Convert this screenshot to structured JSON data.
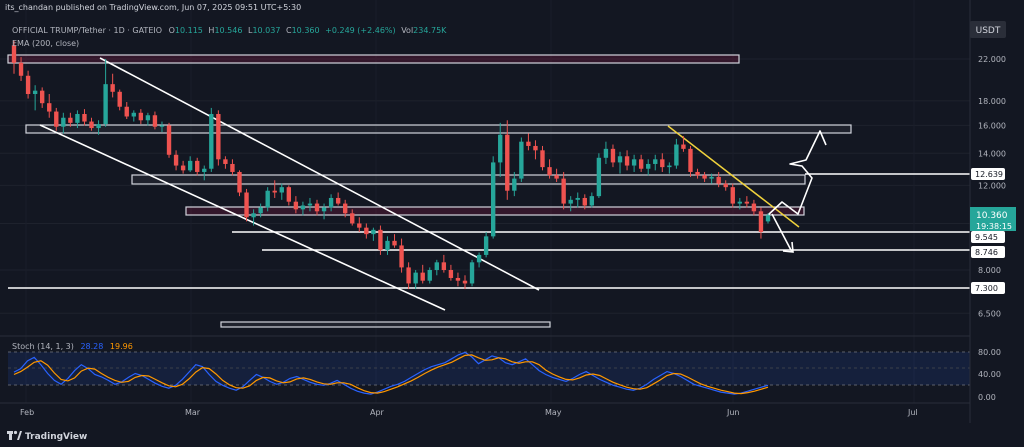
{
  "publish_line": "its_chandan published on TradingView.com, Jun 07, 2025 09:51 UTC+5:30",
  "symbol": {
    "name": "OFFICIAL TRUMP/Tether · 1D · GATEIO",
    "open_label": "O",
    "open": "10.115",
    "high_label": "H",
    "high": "10.546",
    "low_label": "L",
    "low": "10.037",
    "close_label": "C",
    "close": "10.360",
    "change": "+0.249 (+2.46%)",
    "volume_label": "Vol",
    "volume": "234.75K"
  },
  "ema_label": "EMA (200, close)",
  "currency": "USDT",
  "price_axis": {
    "ticks": [
      "22.000",
      "18.000",
      "16.000",
      "14.000",
      "12.000",
      "10.000",
      "8.000",
      "6.500"
    ],
    "badges": [
      "12.639",
      "9.545",
      "8.746",
      "7.300"
    ],
    "current_price": "10.360",
    "countdown": "19:38:15"
  },
  "stoch": {
    "label": "Stoch (14, 1, 3)",
    "k": "28.28",
    "d": "19.96",
    "ticks": [
      "80.00",
      "40.00",
      "0.00"
    ]
  },
  "time_axis": [
    "Feb",
    "Mar",
    "Apr",
    "May",
    "Jun",
    "Jul"
  ],
  "footer_brand": "TradingView",
  "colors": {
    "background": "#131722",
    "up": "#26a69a",
    "down": "#ef5350",
    "stoch_k": "#2962ff",
    "stoch_d": "#ff9800",
    "trendline": "#f0d23c"
  },
  "chart_data": {
    "type": "candlestick",
    "y_scale": "log",
    "interval": "1D",
    "ohlc_last": {
      "open": 10.115,
      "high": 10.546,
      "low": 10.037,
      "close": 10.36
    },
    "candles": [
      [
        23.5,
        24.0,
        20.5,
        21.6
      ],
      [
        21.6,
        22.2,
        19.8,
        20.3
      ],
      [
        20.3,
        20.8,
        18.2,
        18.6
      ],
      [
        18.6,
        19.4,
        17.2,
        18.9
      ],
      [
        18.9,
        19.2,
        17.4,
        17.8
      ],
      [
        17.8,
        18.6,
        16.6,
        17.1
      ],
      [
        17.1,
        17.4,
        15.6,
        15.9
      ],
      [
        15.9,
        17.0,
        15.4,
        16.6
      ],
      [
        16.6,
        17.0,
        15.9,
        16.2
      ],
      [
        16.2,
        17.2,
        15.8,
        16.9
      ],
      [
        16.9,
        17.3,
        16.0,
        16.3
      ],
      [
        16.3,
        16.6,
        15.6,
        15.8
      ],
      [
        15.8,
        16.4,
        15.3,
        16.1
      ],
      [
        16.1,
        22.0,
        15.9,
        19.5
      ],
      [
        19.5,
        20.5,
        18.3,
        18.8
      ],
      [
        18.8,
        19.0,
        17.2,
        17.5
      ],
      [
        17.5,
        17.9,
        16.5,
        16.7
      ],
      [
        16.7,
        17.2,
        16.3,
        17.0
      ],
      [
        17.0,
        17.3,
        16.1,
        16.4
      ],
      [
        16.4,
        17.0,
        16.0,
        16.8
      ],
      [
        16.8,
        17.1,
        15.7,
        15.9
      ],
      [
        15.9,
        16.3,
        15.5,
        16.0
      ],
      [
        16.0,
        16.2,
        13.7,
        13.9
      ],
      [
        13.9,
        14.2,
        12.9,
        13.2
      ],
      [
        13.2,
        13.5,
        12.7,
        12.9
      ],
      [
        12.9,
        13.8,
        12.8,
        13.5
      ],
      [
        13.5,
        13.7,
        12.6,
        12.8
      ],
      [
        12.8,
        13.2,
        12.3,
        13.0
      ],
      [
        13.0,
        17.4,
        12.8,
        16.9
      ],
      [
        16.9,
        17.2,
        13.2,
        13.6
      ],
      [
        13.6,
        13.8,
        13.0,
        13.3
      ],
      [
        13.3,
        13.6,
        12.6,
        12.8
      ],
      [
        12.8,
        12.9,
        11.4,
        11.6
      ],
      [
        11.6,
        11.8,
        10.1,
        10.3
      ],
      [
        10.3,
        10.7,
        9.9,
        10.5
      ],
      [
        10.5,
        11.0,
        10.3,
        10.8
      ],
      [
        10.8,
        11.9,
        10.6,
        11.7
      ],
      [
        11.7,
        12.3,
        11.3,
        11.6
      ],
      [
        11.6,
        12.1,
        11.2,
        11.9
      ],
      [
        11.9,
        12.0,
        10.9,
        11.1
      ],
      [
        11.1,
        11.4,
        10.5,
        10.7
      ],
      [
        10.7,
        11.1,
        10.4,
        10.9
      ],
      [
        10.9,
        11.3,
        10.6,
        11.0
      ],
      [
        11.0,
        11.2,
        10.4,
        10.6
      ],
      [
        10.6,
        11.0,
        10.2,
        10.8
      ],
      [
        10.8,
        11.5,
        10.6,
        11.3
      ],
      [
        11.3,
        11.6,
        10.9,
        11.0
      ],
      [
        11.0,
        11.2,
        10.3,
        10.5
      ],
      [
        10.5,
        10.7,
        9.9,
        10.0
      ],
      [
        10.0,
        10.3,
        9.6,
        9.8
      ],
      [
        9.8,
        10.0,
        9.3,
        9.5
      ],
      [
        9.5,
        9.8,
        9.2,
        9.7
      ],
      [
        9.7,
        9.9,
        8.6,
        8.8
      ],
      [
        8.8,
        9.4,
        8.6,
        9.2
      ],
      [
        9.2,
        9.5,
        8.9,
        9.0
      ],
      [
        9.0,
        9.3,
        7.9,
        8.1
      ],
      [
        8.1,
        8.3,
        7.3,
        7.5
      ],
      [
        7.5,
        8.0,
        7.3,
        7.9
      ],
      [
        7.9,
        8.2,
        7.5,
        7.6
      ],
      [
        7.6,
        8.1,
        7.5,
        8.0
      ],
      [
        8.0,
        8.4,
        7.8,
        8.3
      ],
      [
        8.3,
        8.6,
        7.9,
        8.0
      ],
      [
        8.0,
        8.2,
        7.6,
        7.7
      ],
      [
        7.7,
        7.9,
        7.4,
        7.6
      ],
      [
        7.6,
        7.8,
        7.3,
        7.5
      ],
      [
        7.5,
        8.4,
        7.4,
        8.3
      ],
      [
        8.3,
        8.7,
        8.1,
        8.6
      ],
      [
        8.6,
        9.6,
        8.5,
        9.4
      ],
      [
        9.4,
        13.8,
        9.3,
        13.4
      ],
      [
        13.4,
        16.2,
        12.5,
        15.3
      ],
      [
        15.3,
        16.4,
        11.2,
        11.7
      ],
      [
        11.7,
        12.8,
        11.4,
        12.4
      ],
      [
        12.4,
        15.1,
        12.2,
        14.8
      ],
      [
        14.8,
        15.4,
        14.2,
        14.5
      ],
      [
        14.5,
        14.9,
        13.6,
        14.2
      ],
      [
        14.2,
        14.5,
        12.9,
        13.1
      ],
      [
        13.1,
        13.6,
        12.4,
        12.6
      ],
      [
        12.6,
        13.0,
        12.2,
        12.4
      ],
      [
        12.4,
        12.8,
        10.7,
        11.0
      ],
      [
        11.0,
        11.4,
        10.6,
        11.2
      ],
      [
        11.2,
        11.6,
        10.8,
        11.3
      ],
      [
        11.3,
        11.5,
        10.7,
        10.9
      ],
      [
        10.9,
        11.6,
        10.8,
        11.4
      ],
      [
        11.4,
        14.0,
        11.3,
        13.7
      ],
      [
        13.7,
        14.8,
        13.3,
        14.3
      ],
      [
        14.3,
        14.6,
        13.1,
        13.4
      ],
      [
        13.4,
        14.1,
        12.7,
        13.8
      ],
      [
        13.8,
        14.2,
        12.9,
        13.2
      ],
      [
        13.2,
        13.9,
        12.8,
        13.6
      ],
      [
        13.6,
        13.9,
        12.8,
        13.0
      ],
      [
        13.0,
        13.6,
        12.6,
        13.3
      ],
      [
        13.3,
        13.9,
        12.9,
        13.6
      ],
      [
        13.6,
        14.0,
        12.8,
        13.1
      ],
      [
        13.1,
        13.4,
        12.7,
        13.2
      ],
      [
        13.2,
        15.0,
        13.0,
        14.6
      ],
      [
        14.6,
        15.2,
        14.1,
        14.3
      ],
      [
        14.3,
        14.5,
        12.5,
        12.8
      ],
      [
        12.8,
        13.0,
        12.4,
        12.6
      ],
      [
        12.6,
        12.8,
        12.2,
        12.4
      ],
      [
        12.4,
        12.7,
        12.1,
        12.5
      ],
      [
        12.5,
        12.8,
        11.9,
        12.1
      ],
      [
        12.1,
        12.3,
        11.7,
        11.9
      ],
      [
        11.9,
        12.1,
        10.8,
        11.0
      ],
      [
        11.0,
        11.3,
        10.7,
        11.1
      ],
      [
        11.1,
        11.4,
        10.8,
        11.0
      ],
      [
        11.0,
        11.2,
        10.4,
        10.6
      ],
      [
        10.6,
        10.8,
        9.3,
        9.6
      ],
      [
        10.1,
        10.5,
        10.0,
        10.4
      ]
    ],
    "horizontal_levels": [
      12.639,
      9.545,
      8.746,
      7.3
    ],
    "zones": [
      [
        21.7,
        22.4
      ],
      [
        15.4,
        16.1
      ],
      [
        11.9,
        12.7
      ],
      [
        10.3,
        10.7
      ]
    ],
    "stoch_k": [
      55,
      62,
      78,
      85,
      70,
      52,
      38,
      30,
      42,
      58,
      70,
      62,
      50,
      45,
      38,
      30,
      35,
      44,
      52,
      48,
      40,
      32,
      26,
      22,
      28,
      40,
      55,
      70,
      66,
      50,
      36,
      28,
      22,
      18,
      25,
      38,
      50,
      44,
      36,
      30,
      34,
      42,
      46,
      40,
      34,
      30,
      28,
      32,
      38,
      30,
      22,
      16,
      12,
      10,
      14,
      20,
      26,
      30,
      36,
      44,
      52,
      60,
      66,
      70,
      74,
      82,
      90,
      95,
      86,
      72,
      80,
      88,
      84,
      74,
      70,
      76,
      82,
      70,
      58,
      50,
      44,
      40,
      36,
      42,
      50,
      56,
      48,
      40,
      34,
      28,
      24,
      20,
      18,
      22,
      30,
      40,
      48,
      56,
      52,
      46,
      38,
      30,
      26,
      22,
      18,
      14,
      12,
      10,
      12,
      16,
      20,
      24,
      28
    ],
    "stoch_d": [
      50,
      56,
      65,
      75,
      78,
      69,
      53,
      40,
      37,
      43,
      57,
      63,
      61,
      52,
      44,
      38,
      34,
      36,
      44,
      48,
      47,
      40,
      33,
      27,
      25,
      30,
      41,
      55,
      64,
      62,
      51,
      38,
      29,
      23,
      22,
      27,
      38,
      44,
      43,
      37,
      33,
      35,
      41,
      43,
      40,
      35,
      31,
      30,
      33,
      33,
      30,
      23,
      17,
      13,
      12,
      15,
      20,
      25,
      31,
      37,
      44,
      52,
      59,
      65,
      70,
      75,
      82,
      89,
      90,
      84,
      79,
      80,
      84,
      82,
      76,
      73,
      76,
      76,
      70,
      59,
      51,
      45,
      40,
      39,
      43,
      49,
      51,
      48,
      41,
      34,
      29,
      24,
      21,
      20,
      23,
      31,
      39,
      48,
      52,
      51,
      45,
      38,
      31,
      26,
      22,
      18,
      15,
      12,
      11,
      13,
      16,
      20,
      24
    ],
    "stoch_range": [
      0,
      100
    ],
    "stoch_bands": [
      20,
      80
    ]
  }
}
